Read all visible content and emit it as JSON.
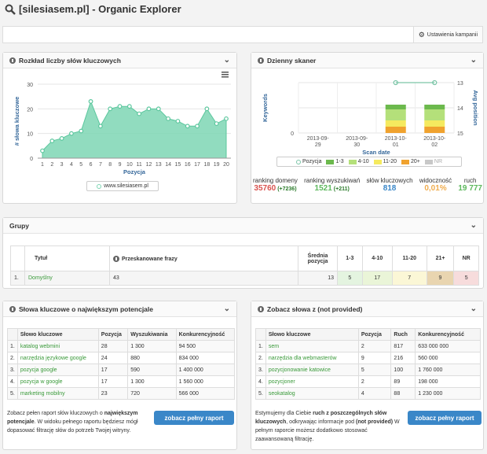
{
  "page": {
    "title": "[silesiasem.pl] - Organic Explorer",
    "settings_label": "Ustawienia kampanii"
  },
  "panel1": {
    "title": "Rozkład liczby słów kluczowych",
    "ylabel": "# słowa kluczowe",
    "xlabel": "Pozycja",
    "legend": "www.silesiasem.pl"
  },
  "chart_data": [
    {
      "type": "area",
      "title": "",
      "xlabel": "Pozycja",
      "ylabel": "# słowa kluczowe",
      "ylim": [
        0,
        30
      ],
      "yticks": [
        "0",
        "10",
        "20",
        "30"
      ],
      "x": [
        1,
        2,
        3,
        4,
        5,
        6,
        7,
        8,
        9,
        10,
        11,
        12,
        13,
        14,
        15,
        16,
        17,
        18,
        19,
        20
      ],
      "series": [
        {
          "name": "www.silesiasem.pl",
          "values": [
            3,
            7,
            8,
            10,
            11,
            23,
            13,
            20,
            21,
            21,
            18,
            20,
            20,
            16,
            15,
            13,
            13,
            20,
            14,
            16
          ]
        }
      ],
      "color": "#7ed6b4"
    },
    {
      "type": "bar",
      "title": "",
      "xlabel": "Scan date",
      "ylabel": "Keywords",
      "y2label": "Avg position",
      "categories": [
        "2013-09-29",
        "2013-09-30",
        "2013-10-01",
        "2013-10-02"
      ],
      "y2ticks": [
        "13",
        "14",
        "15"
      ],
      "legend": [
        "Pozycja",
        "1-3",
        "4-10",
        "11-20",
        "20+",
        "NR"
      ]
    }
  ],
  "panel2": {
    "title": "Dzienny skaner",
    "ylabel": "Keywords",
    "y2label": "Avg position",
    "xlabel": "Scan date",
    "dates": [
      [
        "2013-09-",
        "29"
      ],
      [
        "2013-09-",
        "30"
      ],
      [
        "2013-10-",
        "01"
      ],
      [
        "2013-10-",
        "02"
      ]
    ],
    "legend": [
      {
        "label": "Pozycja",
        "color": "#7cc5a8"
      },
      {
        "label": "1-3",
        "color": "#6cb94d"
      },
      {
        "label": "4-10",
        "color": "#b4e07a"
      },
      {
        "label": "11-20",
        "color": "#f5ea5f"
      },
      {
        "label": "20+",
        "color": "#f0a22e"
      },
      {
        "label": "NR",
        "color": "#c8c8c8"
      }
    ],
    "stats": [
      {
        "label": "ranking domeny",
        "value": "35760",
        "delta": "(+7236)",
        "color": "#d9534f"
      },
      {
        "label": "ranking wyszukiwań",
        "value": "1521",
        "delta": "(+211)",
        "color": "#5cb85c"
      },
      {
        "label": "słów kluczowych",
        "value": "818",
        "delta": "",
        "color": "#3a87c8"
      },
      {
        "label": "widoczność",
        "value": "0,01%",
        "delta": "",
        "color": "#f0ad4e"
      },
      {
        "label": "ruch",
        "value": "19 777",
        "delta": "",
        "color": "#5cb85c"
      }
    ]
  },
  "groups": {
    "title": "Grupy",
    "headers": [
      "Tytuł",
      "Przeskanowane frazy",
      "Średnia pozycja",
      "1-3",
      "4-10",
      "11-20",
      "21+",
      "NR"
    ],
    "rows": [
      {
        "num": "1.",
        "name": "Domyślny",
        "phrases": "43",
        "avg": "13",
        "c1": "5",
        "c2": "17",
        "c3": "7",
        "c4": "9",
        "c5": "5"
      }
    ]
  },
  "kw_potential": {
    "title": "Słowa kluczowe o największym potencjale",
    "headers": [
      "Słowo kluczowe",
      "Pozycja",
      "Wyszukiwania",
      "Konkurencyjność"
    ],
    "rows": [
      {
        "n": "1.",
        "kw": "katalog webmini",
        "pos": "28",
        "search": "1 300",
        "comp": "94 500"
      },
      {
        "n": "2.",
        "kw": "narzędzia językowe google",
        "pos": "24",
        "search": "880",
        "comp": "834 000"
      },
      {
        "n": "3.",
        "kw": "pozycja google",
        "pos": "17",
        "search": "590",
        "comp": "1 400 000"
      },
      {
        "n": "4.",
        "kw": "pozycja w google",
        "pos": "17",
        "search": "1 300",
        "comp": "1 560 000"
      },
      {
        "n": "5.",
        "kw": "marketing mobilny",
        "pos": "23",
        "search": "720",
        "comp": "566 000"
      }
    ],
    "desc_1": "Zobacz pełen raport słów kluczowych o ",
    "desc_bold": "największym potencjale",
    "desc_2": ". W widoku pełnego raportu będziesz mógł dopasować filtrację słów do potrzeb Twojej witryny.",
    "button": "zobacz pełny raport"
  },
  "kw_notprovided": {
    "title": "Zobacz słowa z (not provided)",
    "headers": [
      "Słowo kluczowe",
      "Pozycja",
      "Ruch",
      "Konkurencyjność"
    ],
    "rows": [
      {
        "n": "1.",
        "kw": "sem",
        "pos": "2",
        "search": "817",
        "comp": "633 000 000"
      },
      {
        "n": "2.",
        "kw": "narzędzia dla webmasterów",
        "pos": "9",
        "search": "216",
        "comp": "560 000"
      },
      {
        "n": "3.",
        "kw": "pozycjonowanie katowice",
        "pos": "5",
        "search": "100",
        "comp": "1 760 000"
      },
      {
        "n": "4.",
        "kw": "pozycjoner",
        "pos": "2",
        "search": "89",
        "comp": "198 000"
      },
      {
        "n": "5.",
        "kw": "seokatalog",
        "pos": "4",
        "search": "88",
        "comp": "1 230 000"
      }
    ],
    "desc_1": "Estymujemy dla Ciebie ",
    "desc_bold": "ruch z poszczególnych słów kluczowych",
    "desc_2": ", odkrywając informacje pod ",
    "desc_bold2": "(not provided)",
    "desc_3": " W pełnym raporcie możesz dodatkowo stosować zaawansowaną filtrację.",
    "button": "zobacz pełny raport"
  }
}
